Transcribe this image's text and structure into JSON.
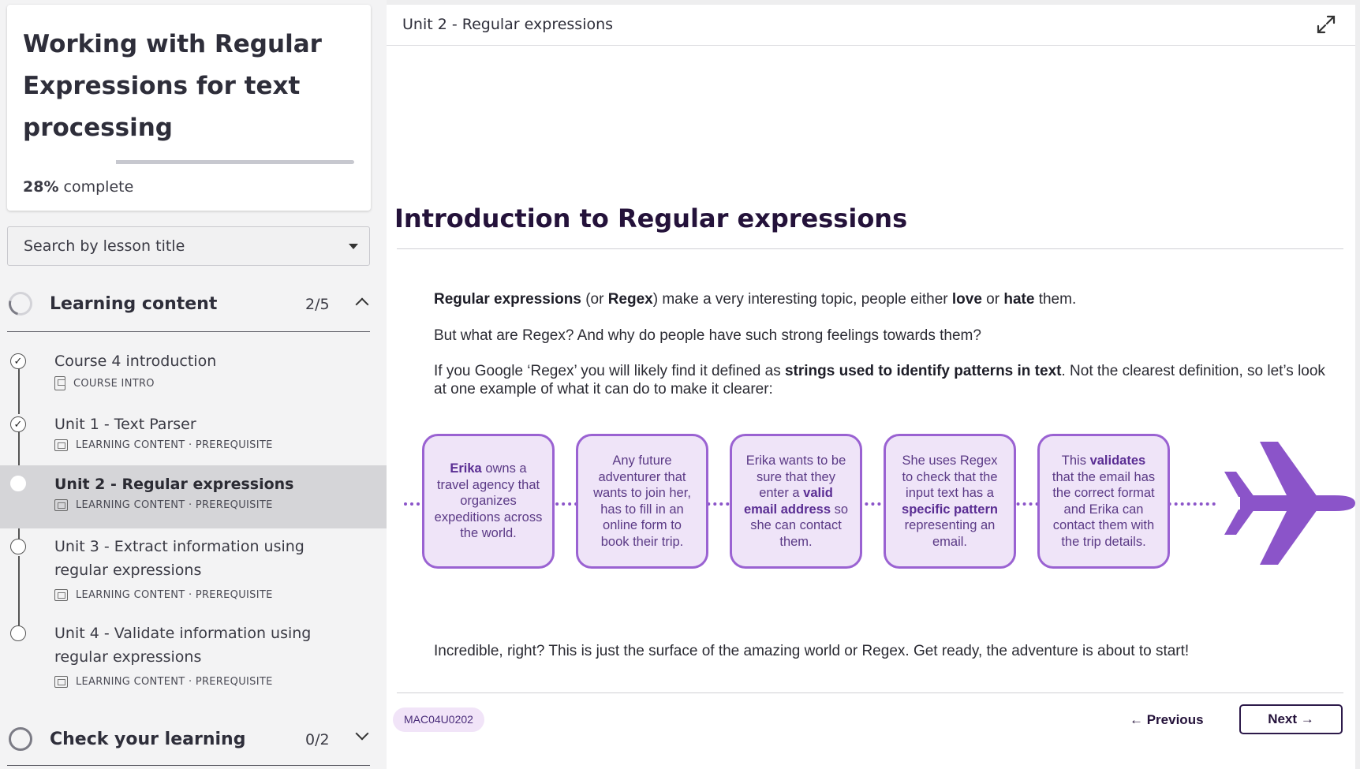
{
  "sidebar": {
    "course": {
      "title": "Working with Regular Expressions for text processing",
      "progress_percent": 28,
      "progress_value": "28%",
      "progress_suffix": " complete"
    },
    "search": {
      "placeholder": "Search by lesson title"
    },
    "sections": [
      {
        "label": "Learning content",
        "count": "2/5",
        "expanded": true
      },
      {
        "label": "Check your learning",
        "count": "0/2",
        "expanded": false
      }
    ],
    "lessons": [
      {
        "title": "Course 4 introduction",
        "meta": "COURSE INTRO",
        "status": "complete",
        "icon": "document-icon"
      },
      {
        "title": "Unit 1 - Text Parser",
        "meta": "LEARNING CONTENT · PREREQUISITE",
        "status": "complete",
        "icon": "slides-icon"
      },
      {
        "title": "Unit 2 - Regular expressions",
        "meta": "LEARNING CONTENT · PREREQUISITE",
        "status": "current",
        "icon": "slides-icon"
      },
      {
        "title": "Unit 3 - Extract information using regular expressions",
        "meta": "LEARNING CONTENT · PREREQUISITE",
        "status": "not-started",
        "icon": "slides-icon"
      },
      {
        "title": "Unit 4 - Validate information using regular expressions",
        "meta": "LEARNING CONTENT · PREREQUISITE",
        "status": "not-started",
        "icon": "slides-icon"
      }
    ]
  },
  "main": {
    "unit_title": "Unit 2 - Regular expressions",
    "heading": "Introduction to Regular expressions",
    "p1": {
      "a": "Regular expressions",
      "b": " (or ",
      "c": "Regex",
      "d": ") make a very interesting topic, people either ",
      "e": "love",
      "f": " or ",
      "g": "hate",
      "h": " them."
    },
    "p2": "But what are Regex? And why do people have such strong feelings towards them?",
    "p3": {
      "a": "If you Google ‘Regex’ you will likely find it defined as ",
      "b": "strings used to identify patterns in text",
      "c": ". Not the clearest definition, so let’s look at one example of what it can do to make it clearer:"
    },
    "flow": [
      {
        "a": "Erika",
        "b": " owns a travel agency that organizes expeditions across the world."
      },
      {
        "a": "Any future adventurer that wants to join her, has to fill in an online form to book their trip."
      },
      {
        "a": "Erika wants to be sure that they enter a ",
        "b": "valid email address",
        "c": " so she can contact them."
      },
      {
        "a": "She uses Regex to check that the input text has a ",
        "b": "specific pattern",
        "c": " representing an email."
      },
      {
        "a": "This ",
        "b": "validates",
        "c": " that the email has the correct format and Erika can contact them with the trip details."
      }
    ],
    "p4": "Incredible, right? This is just the surface of the amazing world or Regex. Get ready, the adventure is about to start!",
    "code": "MAC04U0202",
    "prev_label": "← Previous",
    "next_label": "Next →"
  },
  "colors": {
    "accent": "#8b54c9",
    "box_fill": "#efe4f8",
    "heading": "#24123a"
  }
}
